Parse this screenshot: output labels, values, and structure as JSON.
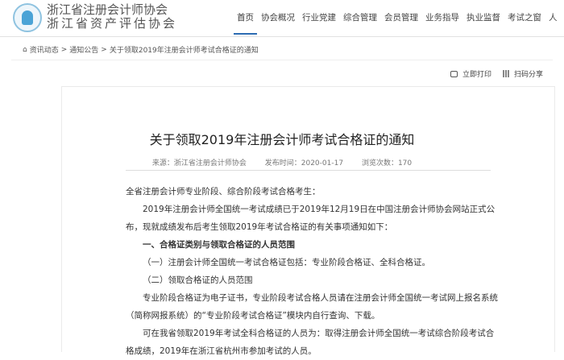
{
  "header": {
    "brand_line1": "浙江省注册会计师协会",
    "brand_line2": "浙江省资产评估协会",
    "nav": [
      "首页",
      "协会概况",
      "行业党建",
      "综合管理",
      "会员管理",
      "业务指导",
      "执业监督",
      "考试之窗",
      "人"
    ]
  },
  "breadcrumb": {
    "items": [
      "资讯动态",
      "通知公告",
      "关于领取2019年注册会计师考试合格证的通知"
    ],
    "sep": ">"
  },
  "tools": {
    "print": "立即打印",
    "share": "扫码分享"
  },
  "article": {
    "title": "关于领取2019年注册会计师考试合格证的通知",
    "source": "来源：浙江省注册会计师协会",
    "date": "发布时间：2020-01-17",
    "views": "浏览次数：170",
    "paragraphs": [
      "全省注册会计师专业阶段、综合阶段考试合格考生：",
      "2019年注册会计师全国统一考试成绩已于2019年12月19日在中国注册会计师协会网站正式公布，现就成绩发布后考生领取2019年考试合格证的有关事项通知如下：",
      "一、合格证类别与领取合格证的人员范围",
      "（一）注册会计师全国统一考试合格证包括：专业阶段合格证、全科合格证。",
      "（二）领取合格证的人员范围",
      "专业阶段合格证为电子证书，专业阶段考试合格人员请在注册会计师全国统一考试网上报名系统（简称网报系统）的“专业阶段考试合格证”模块内自行查询、下载。",
      "可在我省领取2019年考试全科合格证的人员为：取得注册会计师全国统一考试综合阶段考试合格成绩，2019年在浙江省杭州市参加考试的人员。"
    ]
  }
}
